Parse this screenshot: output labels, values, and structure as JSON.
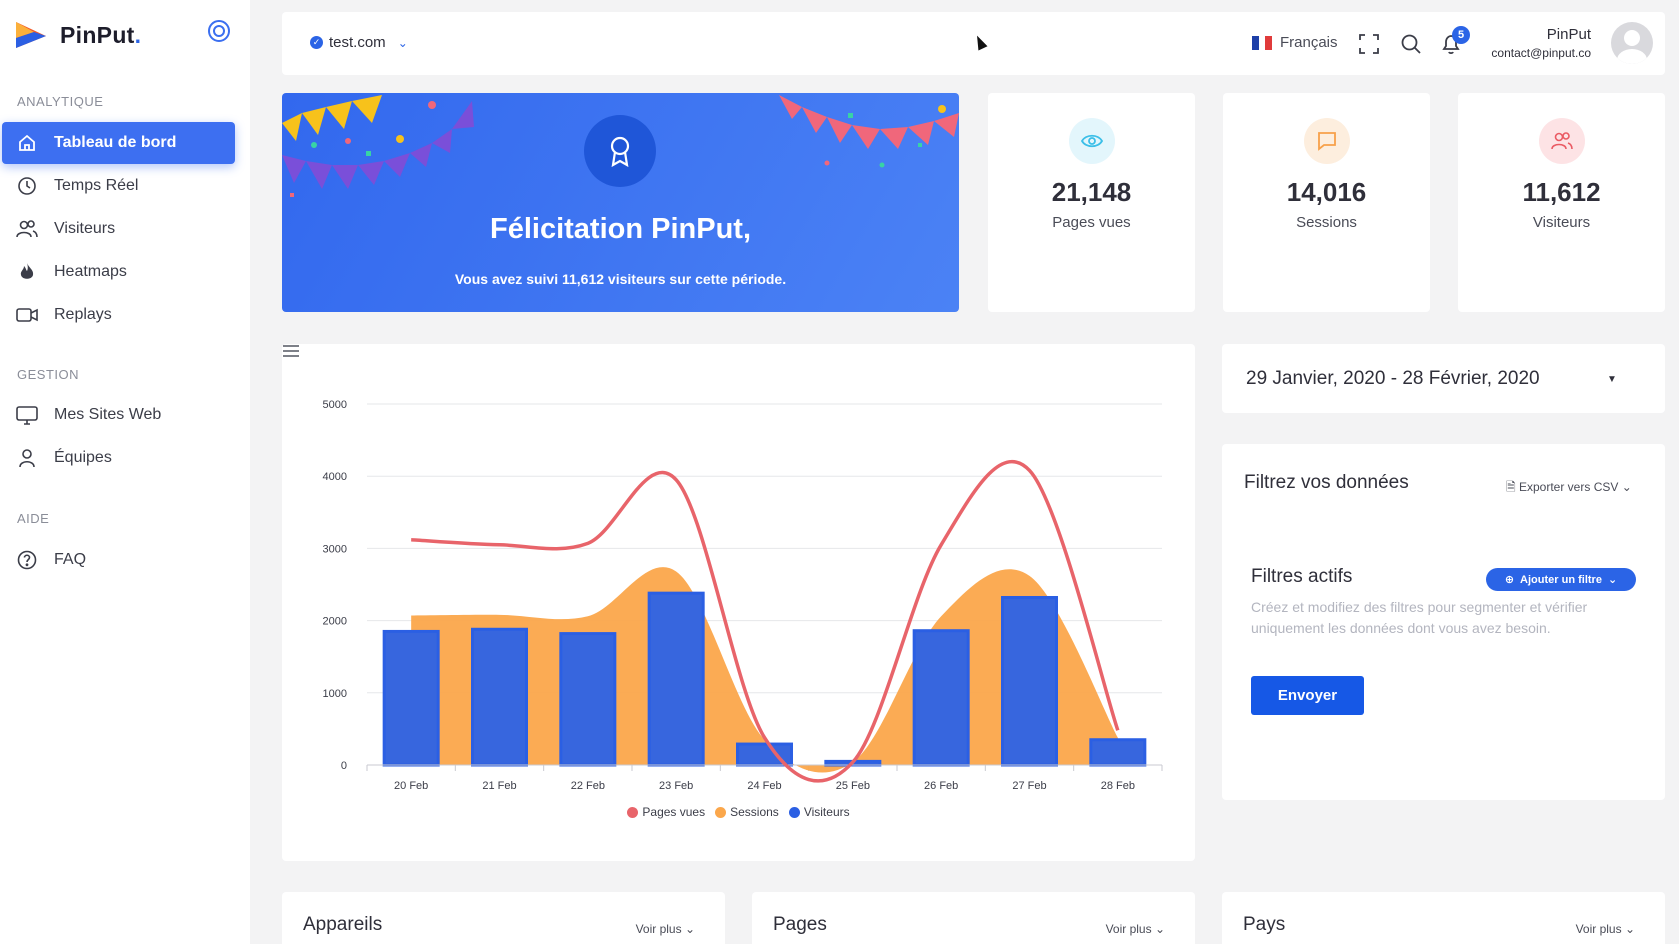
{
  "app": {
    "logo_name": "PinPut",
    "logo_dot": "."
  },
  "sidebar": {
    "sections": [
      {
        "label": "ANALYTIQUE"
      },
      {
        "label": "GESTION"
      },
      {
        "label": "AIDE"
      }
    ],
    "items": [
      {
        "label": "Tableau de bord",
        "icon": "home-icon",
        "active": true
      },
      {
        "label": "Temps Réel",
        "icon": "clock-icon"
      },
      {
        "label": "Visiteurs",
        "icon": "users-icon"
      },
      {
        "label": "Heatmaps",
        "icon": "flame-icon"
      },
      {
        "label": "Replays",
        "icon": "video-icon"
      },
      {
        "label": "Mes Sites Web",
        "icon": "monitor-icon"
      },
      {
        "label": "Équipes",
        "icon": "user-icon"
      },
      {
        "label": "FAQ",
        "icon": "help-icon"
      }
    ]
  },
  "topbar": {
    "site": "test.com",
    "language": "Français",
    "notifications_count": "5",
    "user_name": "PinPut",
    "user_email": "contact@pinput.co"
  },
  "welcome": {
    "title": "Félicitation PinPut,",
    "message": "Vous avez suivi 11,612 visiteurs sur cette période."
  },
  "stats": [
    {
      "value": "21,148",
      "label": "Pages vues",
      "icon": "eye-icon",
      "color": "#3cbfe8",
      "bg": "#e3f6fc"
    },
    {
      "value": "14,016",
      "label": "Sessions",
      "icon": "message-icon",
      "color": "#f7a14a",
      "bg": "#fdeede"
    },
    {
      "value": "11,612",
      "label": "Visiteurs",
      "icon": "users-icon",
      "color": "#ea5a63",
      "bg": "#fde3e5"
    }
  ],
  "date_range": "29 Janvier, 2020 - 28 Février, 2020",
  "filters": {
    "title": "Filtrez vos données",
    "export_label": "Exporter vers CSV",
    "active_title": "Filtres actifs",
    "add_label": "Ajouter un filtre",
    "description": "Créez et modifiez des filtres pour segmenter et vérifier uniquement les données dont vous avez besoin.",
    "submit_label": "Envoyer"
  },
  "bottom_cards": [
    {
      "title": "Appareils",
      "more": "Voir plus"
    },
    {
      "title": "Pages",
      "more": "Voir plus"
    },
    {
      "title": "Pays",
      "more": "Voir plus"
    }
  ],
  "chart_data": {
    "type": "bar",
    "categories": [
      "20 Feb",
      "21 Feb",
      "22 Feb",
      "23 Feb",
      "24 Feb",
      "25 Feb",
      "26 Feb",
      "27 Feb",
      "28 Feb"
    ],
    "ylim": [
      0,
      5000
    ],
    "yticks": [
      0,
      1000,
      2000,
      3000,
      4000,
      5000
    ],
    "series": [
      {
        "name": "Pages vues",
        "render": "line",
        "color": "#e8646a",
        "values": [
          3120,
          3050,
          3070,
          3950,
          380,
          40,
          3050,
          4080,
          480
        ]
      },
      {
        "name": "Sessions",
        "render": "area",
        "color": "#fba74b",
        "values": [
          2070,
          2080,
          2060,
          2680,
          350,
          40,
          2060,
          2620,
          380
        ]
      },
      {
        "name": "Visiteurs",
        "render": "bar",
        "color": "#2b5fe3",
        "values": [
          1850,
          1880,
          1820,
          2380,
          290,
          50,
          1860,
          2320,
          350
        ]
      }
    ],
    "grid": true,
    "legend": "bottom"
  }
}
